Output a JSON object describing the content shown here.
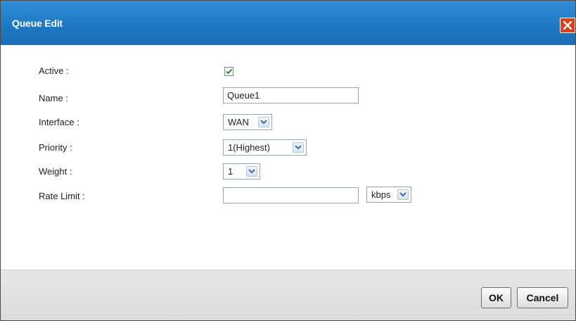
{
  "dialog": {
    "title": "Queue Edit"
  },
  "form": {
    "active_label": "Active :",
    "active_checked": true,
    "name_label": "Name :",
    "name_value": "Queue1",
    "interface_label": "Interface :",
    "interface_value": "WAN",
    "priority_label": "Priority :",
    "priority_value": "1(Highest)",
    "weight_label": "Weight :",
    "weight_value": "1",
    "rate_limit_label": "Rate Limit :",
    "rate_limit_value": "",
    "rate_unit_value": "kbps"
  },
  "footer": {
    "ok_label": "OK",
    "cancel_label": "Cancel"
  },
  "colors": {
    "titlebar": "#1f78c4",
    "close": "#d9411e",
    "footer": "#e0e0e0"
  }
}
